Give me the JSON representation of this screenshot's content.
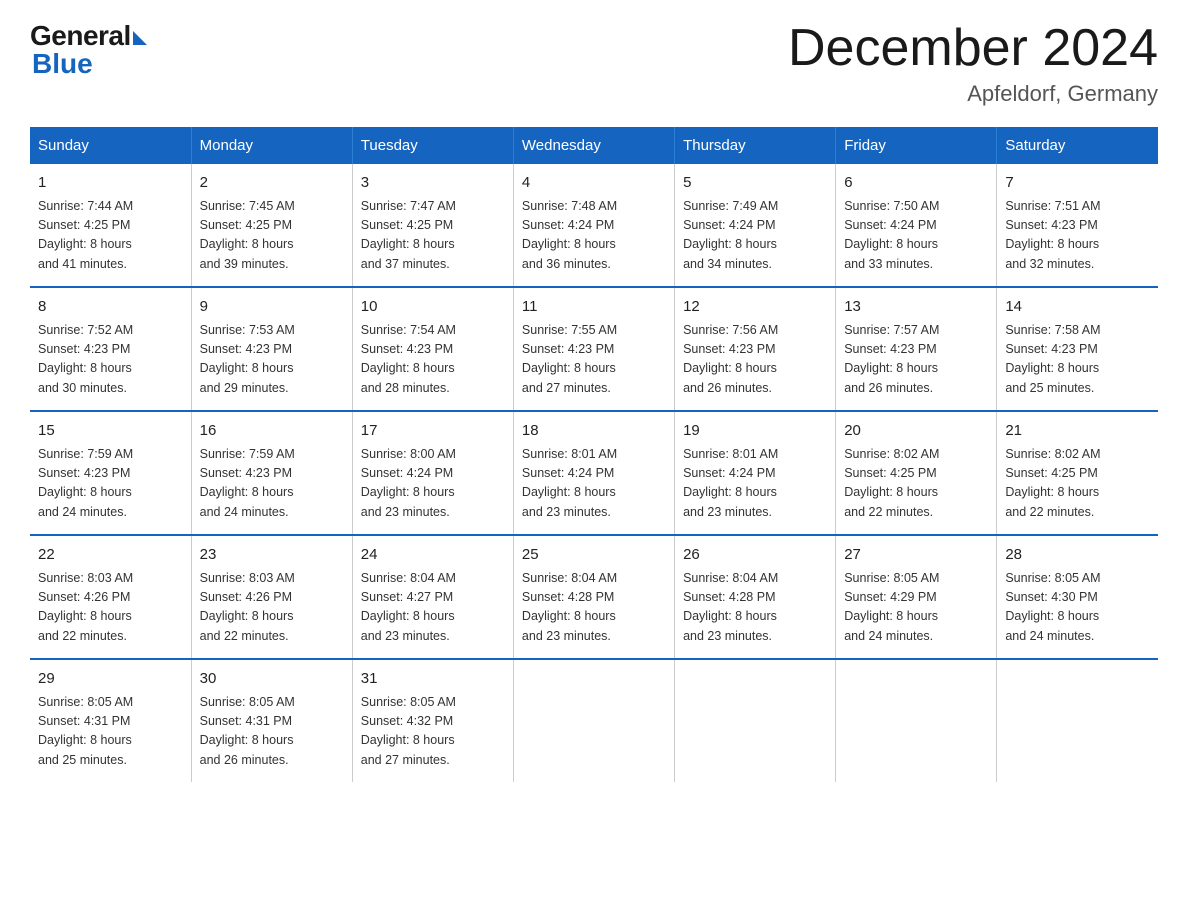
{
  "logo": {
    "general": "General",
    "blue": "Blue"
  },
  "title": "December 2024",
  "subtitle": "Apfeldorf, Germany",
  "header": {
    "days": [
      "Sunday",
      "Monday",
      "Tuesday",
      "Wednesday",
      "Thursday",
      "Friday",
      "Saturday"
    ]
  },
  "weeks": [
    [
      {
        "num": "1",
        "sunrise": "7:44 AM",
        "sunset": "4:25 PM",
        "daylight": "8 hours and 41 minutes."
      },
      {
        "num": "2",
        "sunrise": "7:45 AM",
        "sunset": "4:25 PM",
        "daylight": "8 hours and 39 minutes."
      },
      {
        "num": "3",
        "sunrise": "7:47 AM",
        "sunset": "4:25 PM",
        "daylight": "8 hours and 37 minutes."
      },
      {
        "num": "4",
        "sunrise": "7:48 AM",
        "sunset": "4:24 PM",
        "daylight": "8 hours and 36 minutes."
      },
      {
        "num": "5",
        "sunrise": "7:49 AM",
        "sunset": "4:24 PM",
        "daylight": "8 hours and 34 minutes."
      },
      {
        "num": "6",
        "sunrise": "7:50 AM",
        "sunset": "4:24 PM",
        "daylight": "8 hours and 33 minutes."
      },
      {
        "num": "7",
        "sunrise": "7:51 AM",
        "sunset": "4:23 PM",
        "daylight": "8 hours and 32 minutes."
      }
    ],
    [
      {
        "num": "8",
        "sunrise": "7:52 AM",
        "sunset": "4:23 PM",
        "daylight": "8 hours and 30 minutes."
      },
      {
        "num": "9",
        "sunrise": "7:53 AM",
        "sunset": "4:23 PM",
        "daylight": "8 hours and 29 minutes."
      },
      {
        "num": "10",
        "sunrise": "7:54 AM",
        "sunset": "4:23 PM",
        "daylight": "8 hours and 28 minutes."
      },
      {
        "num": "11",
        "sunrise": "7:55 AM",
        "sunset": "4:23 PM",
        "daylight": "8 hours and 27 minutes."
      },
      {
        "num": "12",
        "sunrise": "7:56 AM",
        "sunset": "4:23 PM",
        "daylight": "8 hours and 26 minutes."
      },
      {
        "num": "13",
        "sunrise": "7:57 AM",
        "sunset": "4:23 PM",
        "daylight": "8 hours and 26 minutes."
      },
      {
        "num": "14",
        "sunrise": "7:58 AM",
        "sunset": "4:23 PM",
        "daylight": "8 hours and 25 minutes."
      }
    ],
    [
      {
        "num": "15",
        "sunrise": "7:59 AM",
        "sunset": "4:23 PM",
        "daylight": "8 hours and 24 minutes."
      },
      {
        "num": "16",
        "sunrise": "7:59 AM",
        "sunset": "4:23 PM",
        "daylight": "8 hours and 24 minutes."
      },
      {
        "num": "17",
        "sunrise": "8:00 AM",
        "sunset": "4:24 PM",
        "daylight": "8 hours and 23 minutes."
      },
      {
        "num": "18",
        "sunrise": "8:01 AM",
        "sunset": "4:24 PM",
        "daylight": "8 hours and 23 minutes."
      },
      {
        "num": "19",
        "sunrise": "8:01 AM",
        "sunset": "4:24 PM",
        "daylight": "8 hours and 23 minutes."
      },
      {
        "num": "20",
        "sunrise": "8:02 AM",
        "sunset": "4:25 PM",
        "daylight": "8 hours and 22 minutes."
      },
      {
        "num": "21",
        "sunrise": "8:02 AM",
        "sunset": "4:25 PM",
        "daylight": "8 hours and 22 minutes."
      }
    ],
    [
      {
        "num": "22",
        "sunrise": "8:03 AM",
        "sunset": "4:26 PM",
        "daylight": "8 hours and 22 minutes."
      },
      {
        "num": "23",
        "sunrise": "8:03 AM",
        "sunset": "4:26 PM",
        "daylight": "8 hours and 22 minutes."
      },
      {
        "num": "24",
        "sunrise": "8:04 AM",
        "sunset": "4:27 PM",
        "daylight": "8 hours and 23 minutes."
      },
      {
        "num": "25",
        "sunrise": "8:04 AM",
        "sunset": "4:28 PM",
        "daylight": "8 hours and 23 minutes."
      },
      {
        "num": "26",
        "sunrise": "8:04 AM",
        "sunset": "4:28 PM",
        "daylight": "8 hours and 23 minutes."
      },
      {
        "num": "27",
        "sunrise": "8:05 AM",
        "sunset": "4:29 PM",
        "daylight": "8 hours and 24 minutes."
      },
      {
        "num": "28",
        "sunrise": "8:05 AM",
        "sunset": "4:30 PM",
        "daylight": "8 hours and 24 minutes."
      }
    ],
    [
      {
        "num": "29",
        "sunrise": "8:05 AM",
        "sunset": "4:31 PM",
        "daylight": "8 hours and 25 minutes."
      },
      {
        "num": "30",
        "sunrise": "8:05 AM",
        "sunset": "4:31 PM",
        "daylight": "8 hours and 26 minutes."
      },
      {
        "num": "31",
        "sunrise": "8:05 AM",
        "sunset": "4:32 PM",
        "daylight": "8 hours and 27 minutes."
      },
      null,
      null,
      null,
      null
    ]
  ],
  "labels": {
    "sunrise_prefix": "Sunrise: ",
    "sunset_prefix": "Sunset: ",
    "daylight_prefix": "Daylight: "
  }
}
